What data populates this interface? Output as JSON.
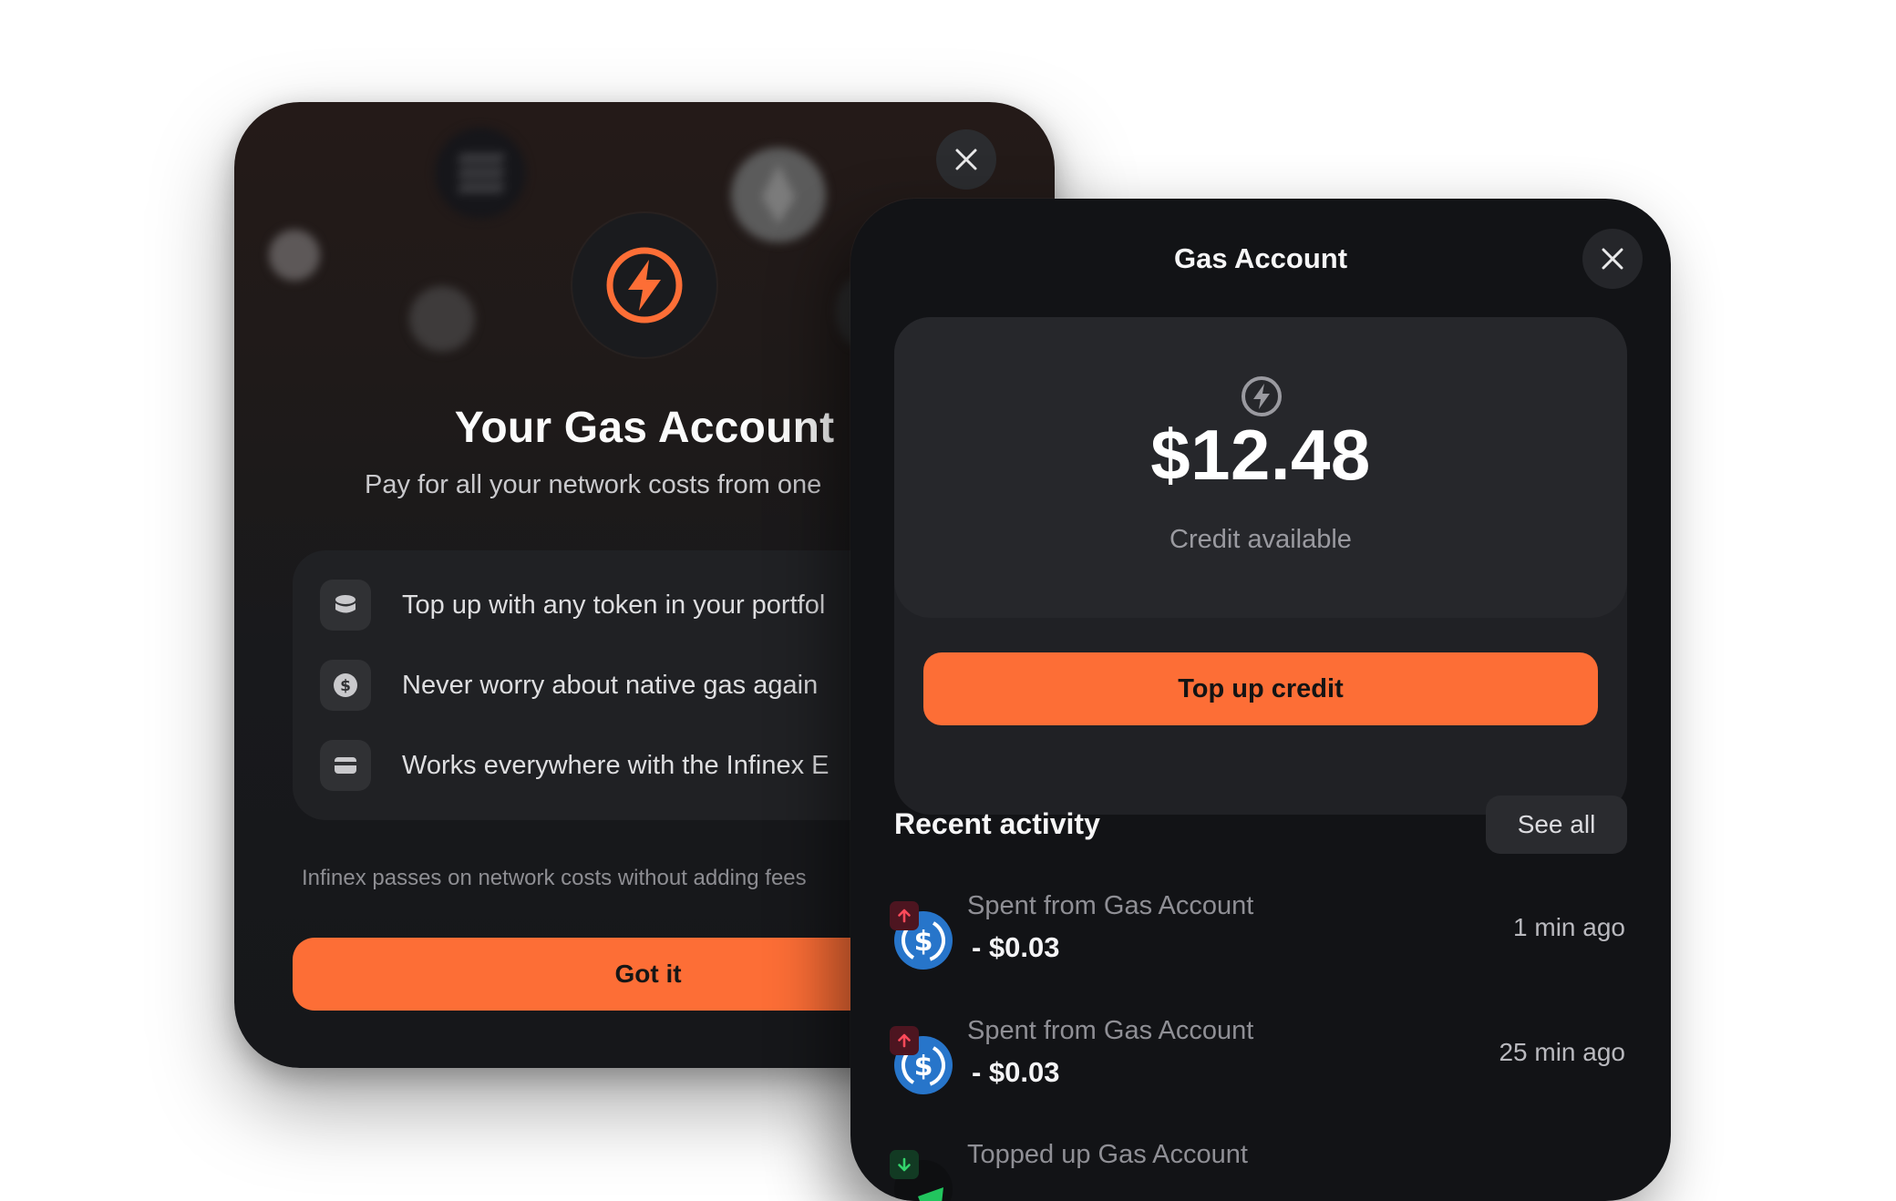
{
  "intro_modal": {
    "title": "Your Gas Account",
    "subtitle": "Pay for all your network costs from one",
    "features": [
      {
        "icon": "coin-stack-icon",
        "text": "Top up with any token in your portfol"
      },
      {
        "icon": "dollar-circle-icon",
        "text": "Never worry about native gas again"
      },
      {
        "icon": "card-icon",
        "text": "Works everywhere with the Infinex E"
      }
    ],
    "note": "Infinex passes on network costs without adding fees",
    "confirm_label": "Got it",
    "close_icon": "close-icon"
  },
  "gas_account": {
    "title": "Gas Account",
    "close_icon": "close-icon",
    "balance": "$12.48",
    "balance_label": "Credit available",
    "topup_label": "Top up credit",
    "recent_activity_title": "Recent activity",
    "see_all_label": "See all",
    "activity": [
      {
        "label": "Spent from Gas Account",
        "amount": "- $0.03",
        "time": "1 min ago",
        "direction": "up",
        "token": "usdc-icon"
      },
      {
        "label": "Spent from Gas Account",
        "amount": "- $0.03",
        "time": "25 min ago",
        "direction": "up",
        "token": "usdc-icon"
      },
      {
        "label": "Topped up Gas Account",
        "amount": "",
        "time": "",
        "direction": "down",
        "token": "token-icon"
      }
    ]
  },
  "colors": {
    "accent": "#fd6e36",
    "panel_bg": "#121316",
    "card_bg": "#202125",
    "usdc_blue": "#2775ca",
    "debit_badge": "#4d1520",
    "credit_badge": "#123a23"
  }
}
